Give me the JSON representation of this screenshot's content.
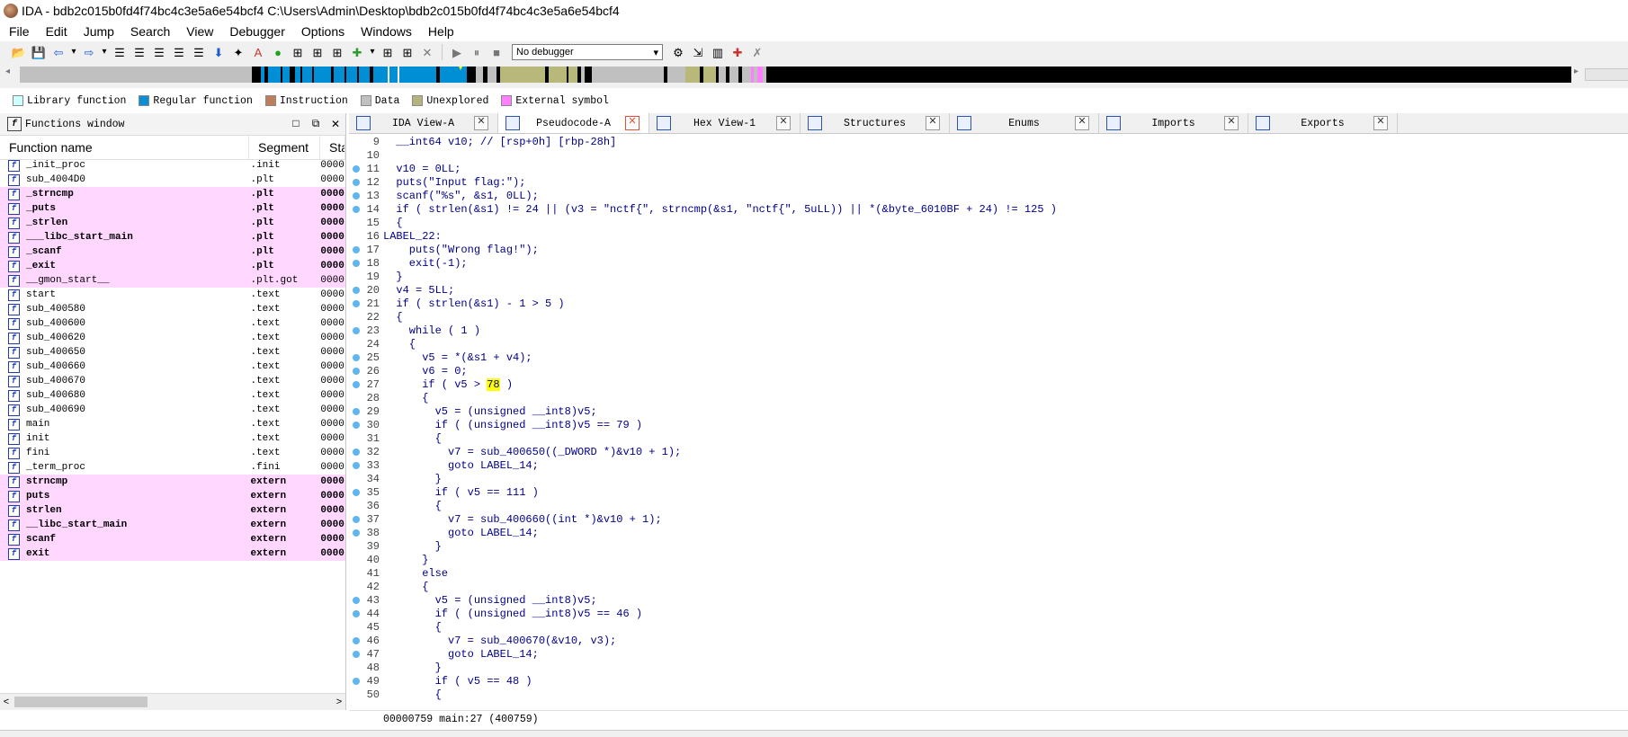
{
  "window": {
    "title": "IDA - bdb2c015b0fd4f74bc4c3e5a6e54bcf4 C:\\Users\\Admin\\Desktop\\bdb2c015b0fd4f74bc4c3e5a6e54bcf4"
  },
  "menu": {
    "items": [
      "File",
      "Edit",
      "Jump",
      "Search",
      "View",
      "Debugger",
      "Options",
      "Windows",
      "Help"
    ]
  },
  "toolbar": {
    "debugger_select": "No debugger",
    "left_icons": [
      "open-icon",
      "save-icon",
      "back-icon",
      "dropdown-icon",
      "forward-icon",
      "dropdown-icon",
      "list-icon",
      "list-icon",
      "list-icon",
      "list-icon",
      "list-icon",
      "down-arrow-icon",
      "star-icon",
      "text-icon",
      "green-circle-icon",
      "graph-icon",
      "graph-icon",
      "graph-icon",
      "add-icon",
      "dropdown-icon",
      "graph-icon",
      "graph-icon",
      "close-icon"
    ],
    "right_icons": [
      "play-icon",
      "pause-icon",
      "stop-icon",
      "debug-settings-icon",
      "attach-icon",
      "bars-icon",
      "breakpoint-icon",
      "remove-breakpoint-icon"
    ]
  },
  "navbar": {
    "colors": {
      "library": "#dbfcfc",
      "regular": "#008fd5",
      "instruction": "#c08a6a",
      "data": "#c0c0c0",
      "unexplored": "#b8b87a",
      "external": "#ff7dff",
      "code_dense": "#000000"
    }
  },
  "legend": [
    {
      "label": "Library function",
      "color": "#ccffff"
    },
    {
      "label": "Regular function",
      "color": "#0a8fd4"
    },
    {
      "label": "Instruction",
      "color": "#bd7f5a"
    },
    {
      "label": "Data",
      "color": "#c0c0c0"
    },
    {
      "label": "Unexplored",
      "color": "#b3b37b"
    },
    {
      "label": "External symbol",
      "color": "#ff80ff"
    }
  ],
  "functions_window": {
    "title": "Functions window",
    "columns": [
      "Function name",
      "Segment",
      "Star"
    ],
    "rows": [
      {
        "name": "_init_proc",
        "segment": ".init",
        "start": "0000",
        "pink": false,
        "bold": false
      },
      {
        "name": "sub_4004D0",
        "segment": ".plt",
        "start": "0000",
        "pink": false,
        "bold": false
      },
      {
        "name": "_strncmp",
        "segment": ".plt",
        "start": "0000",
        "pink": true,
        "bold": true
      },
      {
        "name": "_puts",
        "segment": ".plt",
        "start": "0000",
        "pink": true,
        "bold": true
      },
      {
        "name": "_strlen",
        "segment": ".plt",
        "start": "0000",
        "pink": true,
        "bold": true
      },
      {
        "name": "___libc_start_main",
        "segment": ".plt",
        "start": "0000",
        "pink": true,
        "bold": true
      },
      {
        "name": "_scanf",
        "segment": ".plt",
        "start": "0000",
        "pink": true,
        "bold": true
      },
      {
        "name": "_exit",
        "segment": ".plt",
        "start": "0000",
        "pink": true,
        "bold": true
      },
      {
        "name": "__gmon_start__",
        "segment": ".plt.got",
        "start": "0000",
        "pink": true,
        "bold": false
      },
      {
        "name": "start",
        "segment": ".text",
        "start": "0000",
        "pink": false,
        "bold": false
      },
      {
        "name": "sub_400580",
        "segment": ".text",
        "start": "0000",
        "pink": false,
        "bold": false
      },
      {
        "name": "sub_400600",
        "segment": ".text",
        "start": "0000",
        "pink": false,
        "bold": false
      },
      {
        "name": "sub_400620",
        "segment": ".text",
        "start": "0000",
        "pink": false,
        "bold": false
      },
      {
        "name": "sub_400650",
        "segment": ".text",
        "start": "0000",
        "pink": false,
        "bold": false
      },
      {
        "name": "sub_400660",
        "segment": ".text",
        "start": "0000",
        "pink": false,
        "bold": false
      },
      {
        "name": "sub_400670",
        "segment": ".text",
        "start": "0000",
        "pink": false,
        "bold": false
      },
      {
        "name": "sub_400680",
        "segment": ".text",
        "start": "0000",
        "pink": false,
        "bold": false
      },
      {
        "name": "sub_400690",
        "segment": ".text",
        "start": "0000",
        "pink": false,
        "bold": false
      },
      {
        "name": "main",
        "segment": ".text",
        "start": "0000",
        "pink": false,
        "bold": false
      },
      {
        "name": "init",
        "segment": ".text",
        "start": "0000",
        "pink": false,
        "bold": false
      },
      {
        "name": "fini",
        "segment": ".text",
        "start": "0000",
        "pink": false,
        "bold": false
      },
      {
        "name": "_term_proc",
        "segment": ".fini",
        "start": "0000",
        "pink": false,
        "bold": false
      },
      {
        "name": "strncmp",
        "segment": "extern",
        "start": "0000",
        "pink": true,
        "bold": true
      },
      {
        "name": "puts",
        "segment": "extern",
        "start": "0000",
        "pink": true,
        "bold": true
      },
      {
        "name": "strlen",
        "segment": "extern",
        "start": "0000",
        "pink": true,
        "bold": true
      },
      {
        "name": "__libc_start_main",
        "segment": "extern",
        "start": "0000",
        "pink": true,
        "bold": true
      },
      {
        "name": "scanf",
        "segment": "extern",
        "start": "0000",
        "pink": true,
        "bold": true
      },
      {
        "name": "exit",
        "segment": "extern",
        "start": "0000",
        "pink": true,
        "bold": true
      }
    ]
  },
  "tabs": [
    {
      "label": "IDA View-A",
      "active": false
    },
    {
      "label": "Pseudocode-A",
      "active": true
    },
    {
      "label": "Hex View-1",
      "active": false
    },
    {
      "label": "Structures",
      "active": false
    },
    {
      "label": "Enums",
      "active": false
    },
    {
      "label": "Imports",
      "active": false
    },
    {
      "label": "Exports",
      "active": false
    }
  ],
  "pseudocode": {
    "lines": [
      {
        "n": "9",
        "bp": false,
        "code": "  __int64 v10; // [rsp+0h] [rbp-28h]"
      },
      {
        "n": "10",
        "bp": false,
        "code": ""
      },
      {
        "n": "11",
        "bp": true,
        "code": "  v10 = 0LL;"
      },
      {
        "n": "12",
        "bp": true,
        "code": "  puts(\"Input flag:\");"
      },
      {
        "n": "13",
        "bp": true,
        "code": "  scanf(\"%s\", &s1, 0LL);"
      },
      {
        "n": "14",
        "bp": true,
        "code": "  if ( strlen(&s1) != 24 || (v3 = \"nctf{\", strncmp(&s1, \"nctf{\", 5uLL)) || *(&byte_6010BF + 24) != 125 )"
      },
      {
        "n": "15",
        "bp": false,
        "code": "  {"
      },
      {
        "n": "16",
        "bp": false,
        "code": "LABEL_22:"
      },
      {
        "n": "17",
        "bp": true,
        "code": "    puts(\"Wrong flag!\");"
      },
      {
        "n": "18",
        "bp": true,
        "code": "    exit(-1);"
      },
      {
        "n": "19",
        "bp": false,
        "code": "  }"
      },
      {
        "n": "20",
        "bp": true,
        "code": "  v4 = 5LL;"
      },
      {
        "n": "21",
        "bp": true,
        "code": "  if ( strlen(&s1) - 1 > 5 )"
      },
      {
        "n": "22",
        "bp": false,
        "code": "  {"
      },
      {
        "n": "23",
        "bp": true,
        "code": "    while ( 1 )"
      },
      {
        "n": "24",
        "bp": false,
        "code": "    {"
      },
      {
        "n": "25",
        "bp": true,
        "code": "      v5 = *(&s1 + v4);"
      },
      {
        "n": "26",
        "bp": true,
        "code": "      v6 = 0;"
      },
      {
        "n": "27",
        "bp": true,
        "code": "      if ( v5 > 78 )",
        "hl": "78"
      },
      {
        "n": "28",
        "bp": false,
        "code": "      {"
      },
      {
        "n": "29",
        "bp": true,
        "code": "        v5 = (unsigned __int8)v5;"
      },
      {
        "n": "30",
        "bp": true,
        "code": "        if ( (unsigned __int8)v5 == 79 )"
      },
      {
        "n": "31",
        "bp": false,
        "code": "        {"
      },
      {
        "n": "32",
        "bp": true,
        "code": "          v7 = sub_400650((_DWORD *)&v10 + 1);"
      },
      {
        "n": "33",
        "bp": true,
        "code": "          goto LABEL_14;"
      },
      {
        "n": "34",
        "bp": false,
        "code": "        }"
      },
      {
        "n": "35",
        "bp": true,
        "code": "        if ( v5 == 111 )"
      },
      {
        "n": "36",
        "bp": false,
        "code": "        {"
      },
      {
        "n": "37",
        "bp": true,
        "code": "          v7 = sub_400660((int *)&v10 + 1);"
      },
      {
        "n": "38",
        "bp": true,
        "code": "          goto LABEL_14;"
      },
      {
        "n": "39",
        "bp": false,
        "code": "        }"
      },
      {
        "n": "40",
        "bp": false,
        "code": "      }"
      },
      {
        "n": "41",
        "bp": false,
        "code": "      else"
      },
      {
        "n": "42",
        "bp": false,
        "code": "      {"
      },
      {
        "n": "43",
        "bp": true,
        "code": "        v5 = (unsigned __int8)v5;"
      },
      {
        "n": "44",
        "bp": true,
        "code": "        if ( (unsigned __int8)v5 == 46 )"
      },
      {
        "n": "45",
        "bp": false,
        "code": "        {"
      },
      {
        "n": "46",
        "bp": true,
        "code": "          v7 = sub_400670(&v10, v3);"
      },
      {
        "n": "47",
        "bp": true,
        "code": "          goto LABEL_14;"
      },
      {
        "n": "48",
        "bp": false,
        "code": "        }"
      },
      {
        "n": "49",
        "bp": true,
        "code": "        if ( v5 == 48 )"
      },
      {
        "n": "50",
        "bp": false,
        "code": "        {"
      }
    ]
  },
  "status": {
    "text": "00000759 main:27 (400759)"
  }
}
